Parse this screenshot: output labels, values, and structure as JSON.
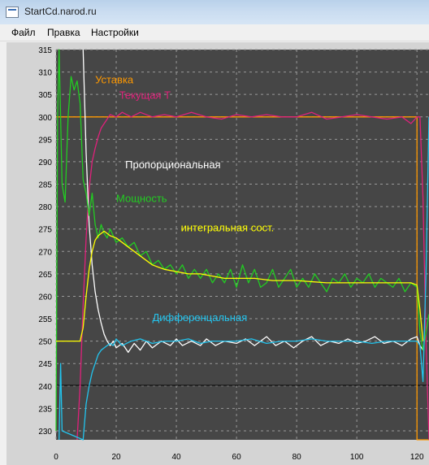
{
  "window": {
    "title": "StartCd.narod.ru",
    "icon": "app-window-icon"
  },
  "menu": [
    {
      "label": "Файл"
    },
    {
      "label": "Правка"
    },
    {
      "label": "Настройки"
    }
  ],
  "colors": {
    "background": "#464646",
    "grid": "#999999",
    "setpoint": "#ff9900",
    "current_t": "#e0217b",
    "proportional": "#ffffff",
    "power": "#22cc22",
    "integral": "#ffff00",
    "differential": "#22c4ee",
    "axis_text": "#000000"
  },
  "chart_data": {
    "type": "line",
    "title": "",
    "xlabel": "",
    "ylabel": "",
    "xlim": [
      0,
      124
    ],
    "ylim": [
      228,
      315
    ],
    "x_ticks": [
      0,
      20,
      40,
      60,
      80,
      100,
      120
    ],
    "y_ticks": [
      230,
      235,
      240,
      245,
      250,
      255,
      260,
      265,
      270,
      275,
      280,
      285,
      290,
      295,
      300,
      305,
      310,
      315
    ],
    "grid": true,
    "series": [
      {
        "name": "Уставка",
        "key": "setpoint",
        "color": "#ff9900",
        "points": [
          [
            0,
            300
          ],
          [
            120,
            300
          ],
          [
            120,
            228
          ],
          [
            124,
            228
          ]
        ]
      },
      {
        "name": "Текущая Т",
        "key": "current_t",
        "color": "#e0217b",
        "points": [
          [
            7,
            228
          ],
          [
            8,
            240
          ],
          [
            9,
            258
          ],
          [
            10,
            273
          ],
          [
            11,
            284
          ],
          [
            12,
            290
          ],
          [
            13,
            293
          ],
          [
            14,
            295.5
          ],
          [
            15,
            297.5
          ],
          [
            16,
            298.5
          ],
          [
            17,
            299.5
          ],
          [
            18,
            300.5
          ],
          [
            20,
            300
          ],
          [
            22,
            301
          ],
          [
            25,
            300
          ],
          [
            28,
            301
          ],
          [
            32,
            300
          ],
          [
            36,
            300.5
          ],
          [
            40,
            300
          ],
          [
            45,
            301
          ],
          [
            50,
            300
          ],
          [
            55,
            299.5
          ],
          [
            60,
            300.5
          ],
          [
            65,
            300
          ],
          [
            70,
            300.5
          ],
          [
            75,
            300
          ],
          [
            80,
            300
          ],
          [
            85,
            301
          ],
          [
            90,
            299.5
          ],
          [
            95,
            300
          ],
          [
            100,
            300.5
          ],
          [
            105,
            300
          ],
          [
            110,
            299.5
          ],
          [
            115,
            300
          ],
          [
            118,
            298.5
          ],
          [
            120,
            300
          ],
          [
            121,
            300
          ],
          [
            122,
            282
          ],
          [
            123,
            250
          ],
          [
            124,
            228
          ]
        ]
      },
      {
        "name": "Пропорциональная",
        "key": "proportional",
        "color": "#ffffff",
        "points": [
          [
            9,
            315
          ],
          [
            10,
            292
          ],
          [
            11,
            276
          ],
          [
            12,
            267
          ],
          [
            13,
            261
          ],
          [
            14,
            257
          ],
          [
            15,
            254
          ],
          [
            16,
            251.5
          ],
          [
            17,
            250
          ],
          [
            18,
            249
          ],
          [
            19,
            250
          ],
          [
            20,
            248.5
          ],
          [
            22,
            249.5
          ],
          [
            24,
            247.5
          ],
          [
            26,
            249.5
          ],
          [
            28,
            248
          ],
          [
            30,
            250
          ],
          [
            32,
            248.5
          ],
          [
            35,
            250
          ],
          [
            38,
            249
          ],
          [
            40,
            250.5
          ],
          [
            42,
            249
          ],
          [
            45,
            250
          ],
          [
            48,
            249
          ],
          [
            50,
            250.5
          ],
          [
            53,
            249
          ],
          [
            56,
            250
          ],
          [
            60,
            249.5
          ],
          [
            63,
            250.5
          ],
          [
            66,
            249
          ],
          [
            70,
            251
          ],
          [
            73,
            249
          ],
          [
            76,
            250
          ],
          [
            79,
            248.5
          ],
          [
            82,
            250
          ],
          [
            85,
            251
          ],
          [
            88,
            249
          ],
          [
            91,
            250
          ],
          [
            94,
            249.5
          ],
          [
            97,
            250.5
          ],
          [
            100,
            249.5
          ],
          [
            103,
            250
          ],
          [
            106,
            251
          ],
          [
            109,
            249.5
          ],
          [
            112,
            250
          ],
          [
            115,
            249
          ],
          [
            118,
            250.5
          ],
          [
            120,
            251
          ],
          [
            121,
            249
          ],
          [
            122,
            248
          ]
        ]
      },
      {
        "name": "Мощность",
        "key": "power",
        "color": "#22cc22",
        "points": [
          [
            0,
            230
          ],
          [
            0.5,
            300
          ],
          [
            1,
            315
          ],
          [
            1.5,
            300
          ],
          [
            2,
            285
          ],
          [
            3,
            281
          ],
          [
            4,
            300
          ],
          [
            5,
            309
          ],
          [
            6,
            306
          ],
          [
            7,
            308
          ],
          [
            8,
            303
          ],
          [
            9,
            286
          ],
          [
            10,
            283
          ],
          [
            11,
            278
          ],
          [
            12,
            283
          ],
          [
            13,
            276
          ],
          [
            14,
            273
          ],
          [
            15,
            276
          ],
          [
            16,
            274
          ],
          [
            17,
            273
          ],
          [
            18,
            275
          ],
          [
            20,
            272
          ],
          [
            22,
            273
          ],
          [
            24,
            271
          ],
          [
            26,
            272
          ],
          [
            28,
            269
          ],
          [
            30,
            270
          ],
          [
            32,
            267
          ],
          [
            34,
            268
          ],
          [
            36,
            266
          ],
          [
            38,
            267
          ],
          [
            40,
            265
          ],
          [
            42,
            267
          ],
          [
            44,
            264
          ],
          [
            46,
            266
          ],
          [
            48,
            264
          ],
          [
            50,
            266
          ],
          [
            52,
            263
          ],
          [
            54,
            265
          ],
          [
            56,
            263
          ],
          [
            58,
            266
          ],
          [
            60,
            262
          ],
          [
            62,
            267
          ],
          [
            64,
            263
          ],
          [
            66,
            266
          ],
          [
            68,
            262
          ],
          [
            70,
            263
          ],
          [
            72,
            266
          ],
          [
            74,
            262
          ],
          [
            76,
            264
          ],
          [
            78,
            266
          ],
          [
            80,
            262
          ],
          [
            82,
            264
          ],
          [
            84,
            262
          ],
          [
            86,
            265
          ],
          [
            88,
            263
          ],
          [
            90,
            261
          ],
          [
            92,
            264
          ],
          [
            94,
            263
          ],
          [
            96,
            265
          ],
          [
            98,
            262
          ],
          [
            100,
            264
          ],
          [
            102,
            263
          ],
          [
            104,
            265
          ],
          [
            106,
            262
          ],
          [
            108,
            264
          ],
          [
            110,
            263
          ],
          [
            112,
            262
          ],
          [
            114,
            264
          ],
          [
            116,
            261
          ],
          [
            118,
            263
          ],
          [
            120,
            262
          ],
          [
            121,
            252
          ],
          [
            122,
            248
          ],
          [
            123,
            252
          ],
          [
            124,
            256
          ]
        ]
      },
      {
        "name": "интегральная сост.",
        "key": "integral",
        "color": "#ffff00",
        "points": [
          [
            0,
            250
          ],
          [
            8,
            250
          ],
          [
            9,
            253
          ],
          [
            10,
            260
          ],
          [
            11,
            266
          ],
          [
            12,
            270
          ],
          [
            13,
            272.5
          ],
          [
            14,
            273.5
          ],
          [
            16,
            274.5
          ],
          [
            18,
            273.5
          ],
          [
            20,
            273
          ],
          [
            22,
            272
          ],
          [
            24,
            271
          ],
          [
            26,
            270
          ],
          [
            28,
            269
          ],
          [
            30,
            268
          ],
          [
            32,
            267
          ],
          [
            34,
            266.5
          ],
          [
            36,
            266
          ],
          [
            40,
            265.5
          ],
          [
            44,
            265
          ],
          [
            48,
            265
          ],
          [
            52,
            264.5
          ],
          [
            56,
            264
          ],
          [
            60,
            264
          ],
          [
            66,
            264
          ],
          [
            72,
            263.5
          ],
          [
            80,
            263.5
          ],
          [
            90,
            263
          ],
          [
            100,
            263
          ],
          [
            110,
            263
          ],
          [
            118,
            263
          ],
          [
            120,
            262.5
          ],
          [
            121,
            257
          ],
          [
            122,
            250
          ]
        ]
      },
      {
        "name": "Дифференцальная",
        "key": "differential",
        "color": "#22c4ee",
        "points": [
          [
            1,
            228
          ],
          [
            1.5,
            245
          ],
          [
            2,
            230
          ],
          [
            9,
            228
          ],
          [
            10,
            236
          ],
          [
            11,
            240
          ],
          [
            12,
            243
          ],
          [
            13,
            245
          ],
          [
            14,
            247
          ],
          [
            15,
            248
          ],
          [
            16,
            248.5
          ],
          [
            17,
            249
          ],
          [
            18,
            249.5
          ],
          [
            19,
            249
          ],
          [
            20,
            250.5
          ],
          [
            22,
            249
          ],
          [
            25,
            250
          ],
          [
            28,
            250.5
          ],
          [
            32,
            249.5
          ],
          [
            36,
            250
          ],
          [
            40,
            250
          ],
          [
            44,
            250.5
          ],
          [
            48,
            249.5
          ],
          [
            52,
            250
          ],
          [
            56,
            250
          ],
          [
            60,
            250
          ],
          [
            65,
            250.5
          ],
          [
            70,
            249.5
          ],
          [
            75,
            250
          ],
          [
            80,
            250
          ],
          [
            85,
            250.5
          ],
          [
            90,
            250
          ],
          [
            95,
            250
          ],
          [
            100,
            250
          ],
          [
            105,
            249.5
          ],
          [
            110,
            250
          ],
          [
            115,
            250
          ],
          [
            118,
            250
          ],
          [
            120,
            250
          ],
          [
            121,
            249
          ],
          [
            122,
            241
          ],
          [
            123,
            265
          ],
          [
            124,
            300
          ]
        ]
      }
    ],
    "labels": [
      {
        "text": "Уставка",
        "key": "setpoint",
        "x": 13,
        "y": 307.5
      },
      {
        "text": "Текущая Т",
        "key": "current_t",
        "x": 21,
        "y": 304
      },
      {
        "text": "Пропорциональная",
        "key": "proportional",
        "x": 23,
        "y": 288.5
      },
      {
        "text": "Мощность",
        "key": "power",
        "x": 20,
        "y": 281
      },
      {
        "text": "интегральная сост.",
        "key": "integral",
        "x": 41.5,
        "y": 274.5
      },
      {
        "text": "Дифференцальная",
        "key": "differential",
        "x": 32,
        "y": 254.5
      }
    ]
  }
}
